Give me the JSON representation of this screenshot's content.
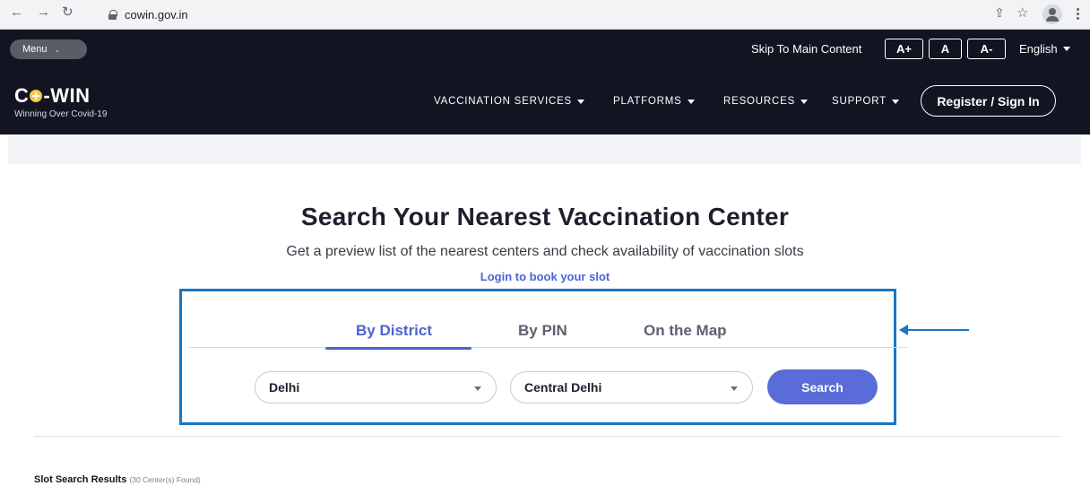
{
  "browser": {
    "url": "cowin.gov.in"
  },
  "topbar": {
    "menu_label": "Menu",
    "skip_label": "Skip To Main Content",
    "font_increase": "A+",
    "font_normal": "A",
    "font_decrease": "A-",
    "language": "English"
  },
  "header": {
    "logo_prefix": "C",
    "logo_suffix": "-WIN",
    "tagline": "Winning Over Covid-19",
    "nav": [
      {
        "label": "VACCINATION SERVICES"
      },
      {
        "label": "PLATFORMS"
      },
      {
        "label": "RESOURCES"
      },
      {
        "label": "SUPPORT"
      }
    ],
    "signin_label": "Register / Sign In"
  },
  "hero": {
    "title": "Search Your Nearest Vaccination Center",
    "subtitle": "Get a preview list of the nearest centers and check availability of vaccination slots",
    "login_link": "Login to book your slot"
  },
  "search": {
    "tabs": [
      {
        "label": "By District",
        "active": true
      },
      {
        "label": "By PIN",
        "active": false
      },
      {
        "label": "On the Map",
        "active": false
      }
    ],
    "state_value": "Delhi",
    "district_value": "Central Delhi",
    "search_label": "Search"
  },
  "results": {
    "label": "Slot Search Results",
    "count": "(30 Center(s) Found)"
  },
  "colors": {
    "header_bg": "#121421",
    "accent": "#4c63d2",
    "search_button": "#5a6cd8",
    "annotation": "#1a76c0"
  }
}
